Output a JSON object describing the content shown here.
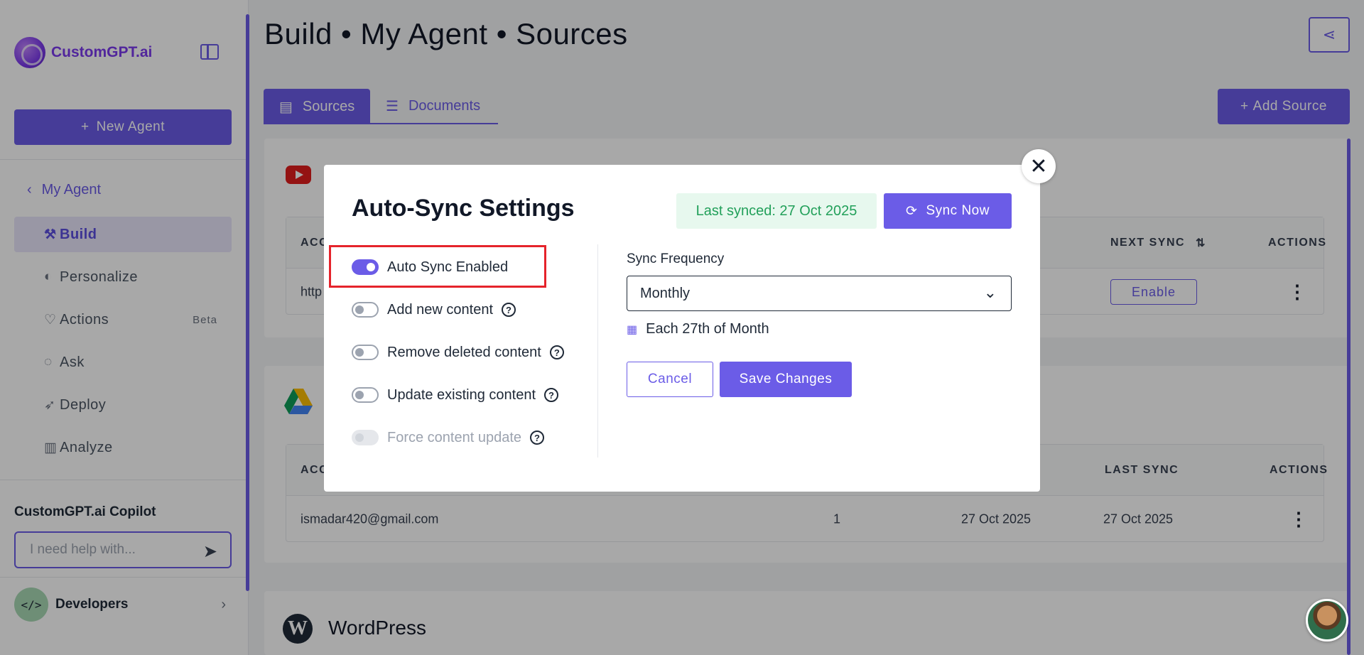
{
  "sidebar": {
    "logo_text": "CustomGPT.ai",
    "new_agent_label": "New Agent",
    "agent_name": "My Agent",
    "items": [
      {
        "label": "Build",
        "icon": "build-icon"
      },
      {
        "label": "Personalize",
        "icon": "palette-icon"
      },
      {
        "label": "Actions",
        "icon": "actions-icon",
        "badge": "Beta"
      },
      {
        "label": "Ask",
        "icon": "chat-icon"
      },
      {
        "label": "Deploy",
        "icon": "rocket-icon"
      },
      {
        "label": "Analyze",
        "icon": "bar-chart-icon"
      }
    ],
    "copilot_title": "CustomGPT.ai Copilot",
    "copilot_placeholder": "I need help with...",
    "developers_label": "Developers"
  },
  "header": {
    "title": "Build • My Agent • Sources"
  },
  "tabs": {
    "sources": "Sources",
    "documents": "Documents"
  },
  "add_source_label": "Add Source",
  "youtube_table": {
    "headers": {
      "account": "ACC",
      "next_sync": "NEXT SYNC",
      "actions": "ACTIONS"
    },
    "row": {
      "url_prefix": "http",
      "enable_label": "Enable"
    }
  },
  "gdrive_table": {
    "headers": {
      "account": "ACC",
      "last_sync": "LAST SYNC",
      "actions": "ACTIONS"
    },
    "row": {
      "email": "ismadar420@gmail.com",
      "count": "1",
      "date1": "27 Oct 2025",
      "date2": "27 Oct 2025"
    }
  },
  "wordpress_title": "WordPress",
  "modal": {
    "title": "Auto-Sync Settings",
    "last_synced": "Last synced: 27 Oct 2025",
    "sync_now": "Sync Now",
    "toggles": [
      {
        "label": "Auto Sync Enabled",
        "state": "on"
      },
      {
        "label": "Add new content",
        "state": "off"
      },
      {
        "label": "Remove deleted content",
        "state": "off"
      },
      {
        "label": "Update existing content",
        "state": "off"
      },
      {
        "label": "Force content update",
        "state": "disabled"
      }
    ],
    "frequency_label": "Sync Frequency",
    "frequency_value": "Monthly",
    "schedule_text": "Each 27th of Month",
    "cancel_label": "Cancel",
    "save_label": "Save Changes"
  },
  "colors": {
    "accent": "#6b5ce7",
    "success_bg": "#e7f8ee",
    "success_text": "#22a05a",
    "highlight": "#e5232b"
  }
}
